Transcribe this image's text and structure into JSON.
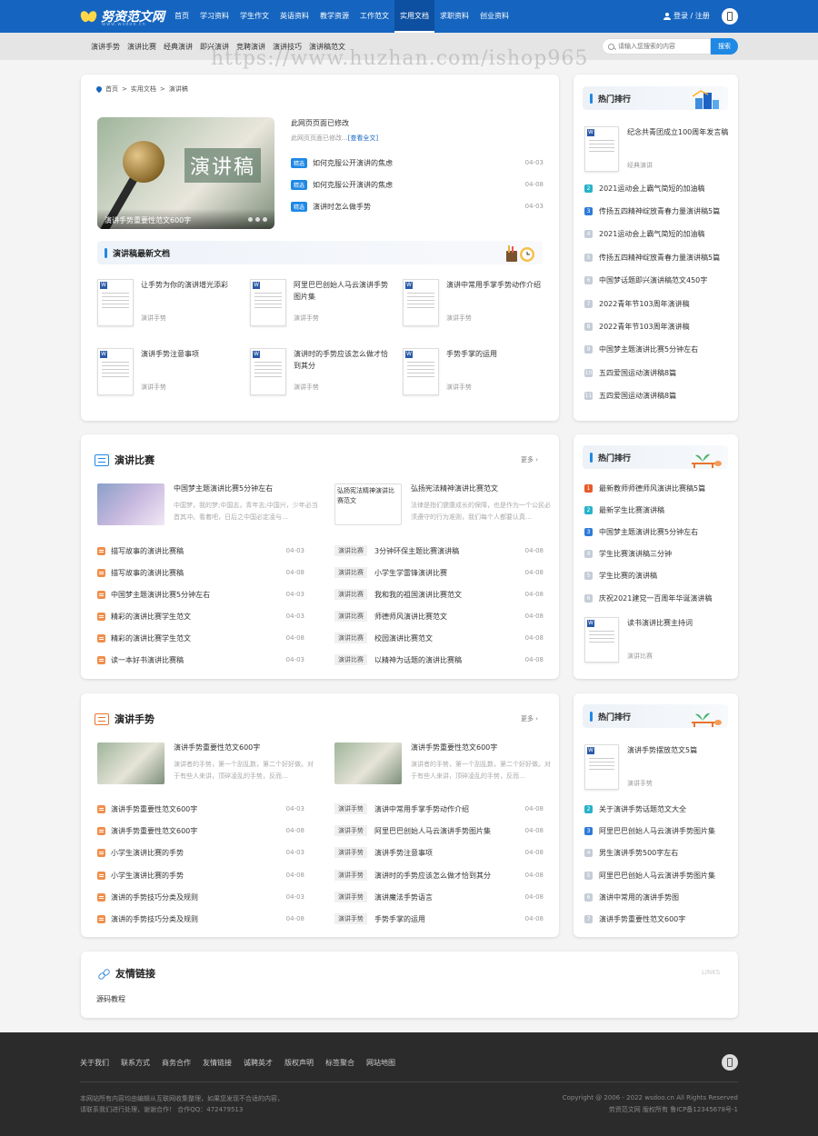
{
  "header": {
    "logo_text": "努资范文网",
    "logo_sub": "www.wsdoo.cn",
    "nav": [
      "首页",
      "学习资料",
      "学生作文",
      "英语资料",
      "教学资源",
      "工作范文",
      "实用文档",
      "求职资料",
      "创业资料"
    ],
    "active_nav": "实用文档",
    "login": "登录 / 注册"
  },
  "subnav": [
    "演讲手势",
    "演讲比赛",
    "经典演讲",
    "即兴演讲",
    "竞聘演讲",
    "演讲技巧",
    "演讲稿范文"
  ],
  "search": {
    "placeholder": "请输入您搜索的内容",
    "button": "搜索"
  },
  "watermark": "https://www.huzhan.com/ishop965",
  "breadcrumb": [
    "首页",
    "实用文档",
    "演讲稿"
  ],
  "banner": {
    "word": "演讲稿",
    "caption": "演讲手势重要性范文600字"
  },
  "headline": {
    "title": "此网页页面已修改",
    "desc": "此网页页面已修改...",
    "more": "[查看全文]",
    "items": [
      {
        "tag": "精选",
        "title": "如何克服公开演讲的焦虑",
        "date": "04-03"
      },
      {
        "tag": "精选",
        "title": "如何克服公开演讲的焦虑",
        "date": "04-08"
      },
      {
        "tag": "精选",
        "title": "演讲时怎么做手势",
        "date": "04-03"
      }
    ]
  },
  "latest": {
    "title": "演讲稿最新文档",
    "items": [
      {
        "title": "让手势为你的演讲增光添彩",
        "cat": "演讲手势"
      },
      {
        "title": "阿里巴巴创始人马云演讲手势图片集",
        "cat": "演讲手势"
      },
      {
        "title": "演讲中常用手掌手势动作介绍",
        "cat": "演讲手势"
      },
      {
        "title": "演讲手势注意事项",
        "cat": "演讲手势"
      },
      {
        "title": "演讲时的手势应该怎么做才恰到其分",
        "cat": "演讲手势"
      },
      {
        "title": "手势手掌的运用",
        "cat": "演讲手势"
      }
    ]
  },
  "hot1": {
    "title": "热门排行",
    "feature": {
      "title": "纪念共青团成立100周年发言稿",
      "cat": "经典演讲"
    },
    "items": [
      "2021运动会上霸气简短的加油稿",
      "传扬五四精神绽放青春力量演讲稿5篇",
      "2021运动会上霸气简短的加油稿",
      "传扬五四精神绽放青春力量演讲稿5篇",
      "中国梦话题即兴演讲稿范文450字",
      "2022青年节103周年演讲稿",
      "2022青年节103周年演讲稿",
      "中国梦主题演讲比赛5分钟左右",
      "五四爱国运动演讲稿8篇",
      "五四爱国运动演讲稿8篇"
    ],
    "nums": [
      "2",
      "3",
      "4",
      "5",
      "6",
      "7",
      "8",
      "9",
      "10",
      "11"
    ]
  },
  "contest": {
    "title": "演讲比赛",
    "more": "更多",
    "feat1": {
      "title": "中国梦主题演讲比赛5分钟左右",
      "desc": "中国梦，我的梦;中国志，青年志;中国兴，少年必当首其冲。看着吧，日后之中国必定凌与..."
    },
    "feat2": {
      "title": "弘扬宪法精神演讲比赛范文",
      "desc": "法律是指们健康成长的保障，也是作为一个公民必须遵守的行为准则，我们每个人都要认真...",
      "img_alt": "弘扬宪法精神演讲比赛范文"
    },
    "left": [
      {
        "title": "描写故事的演讲比赛稿",
        "date": "04-03"
      },
      {
        "title": "描写故事的演讲比赛稿",
        "date": "04-08"
      },
      {
        "title": "中国梦主题演讲比赛5分钟左右",
        "date": "04-03"
      },
      {
        "title": "精彩的演讲比赛学生范文",
        "date": "04-03"
      },
      {
        "title": "精彩的演讲比赛学生范文",
        "date": "04-08"
      },
      {
        "title": "读一本好书演讲比赛稿",
        "date": "04-03"
      }
    ],
    "right": [
      {
        "tag": "演讲比赛",
        "title": "3分钟环保主题比赛演讲稿",
        "date": "04-08"
      },
      {
        "tag": "演讲比赛",
        "title": "小学生学雷锋演讲比赛",
        "date": "04-08"
      },
      {
        "tag": "演讲比赛",
        "title": "我和我的祖国演讲比赛范文",
        "date": "04-08"
      },
      {
        "tag": "演讲比赛",
        "title": "师德师风演讲比赛范文",
        "date": "04-08"
      },
      {
        "tag": "演讲比赛",
        "title": "校园演讲比赛范文",
        "date": "04-08"
      },
      {
        "tag": "演讲比赛",
        "title": "以精神为话题的演讲比赛稿",
        "date": "04-08"
      }
    ]
  },
  "hot2": {
    "title": "热门排行",
    "items": [
      "最新教师师德师风演讲比赛稿5篇",
      "最新学生比赛演讲稿",
      "中国梦主题演讲比赛5分钟左右",
      "学生比赛演讲稿三分钟",
      "学生比赛的演讲稿",
      "庆祝2021建党一百周年华诞演讲稿"
    ],
    "nums": [
      "1",
      "2",
      "3",
      "4",
      "5",
      "6"
    ],
    "feature": {
      "title": "读书演讲比赛主持词",
      "cat": "演讲比赛"
    }
  },
  "gesture": {
    "title": "演讲手势",
    "more": "更多",
    "feat1": {
      "title": "演讲手势重要性范文600字",
      "desc": "演讲者的手势，第一个刮乱数，第二个好好做。对于有些人来讲，顶碎凌乱的手势，反而..."
    },
    "feat2": {
      "title": "演讲手势重要性范文600字",
      "desc": "演讲者的手势，第一个刮乱数，第二个好好做。对于有些人来讲，顶碎凌乱的手势，反而..."
    },
    "left": [
      {
        "title": "演讲手势重要性范文600字",
        "date": "04-03"
      },
      {
        "title": "演讲手势重要性范文600字",
        "date": "04-08"
      },
      {
        "title": "小学生演讲比赛的手势",
        "date": "04-03"
      },
      {
        "title": "小学生演讲比赛的手势",
        "date": "04-08"
      },
      {
        "title": "演讲的手势技巧分类及规则",
        "date": "04-03"
      },
      {
        "title": "演讲的手势技巧分类及规则",
        "date": "04-08"
      }
    ],
    "right": [
      {
        "tag": "演讲手势",
        "title": "演讲中常用手掌手势动作介绍",
        "date": "04-08"
      },
      {
        "tag": "演讲手势",
        "title": "阿里巴巴创始人马云演讲手势图片集",
        "date": "04-08"
      },
      {
        "tag": "演讲手势",
        "title": "演讲手势注意事项",
        "date": "04-08"
      },
      {
        "tag": "演讲手势",
        "title": "演讲时的手势应该怎么做才恰到其分",
        "date": "04-08"
      },
      {
        "tag": "演讲手势",
        "title": "演讲魔法手势语言",
        "date": "04-08"
      },
      {
        "tag": "演讲手势",
        "title": "手势手掌的运用",
        "date": "04-08"
      }
    ]
  },
  "hot3": {
    "title": "热门排行",
    "feature": {
      "title": "演讲手势摆放范文5篇",
      "cat": "演讲手势"
    },
    "items": [
      "关于演讲手势话题范文大全",
      "阿里巴巴创始人马云演讲手势图片集",
      "男生演讲手势500字左右",
      "阿里巴巴创始人马云演讲手势图片集",
      "演讲中常用的演讲手势图",
      "演讲手势重要性范文600字"
    ],
    "nums": [
      "2",
      "3",
      "4",
      "5",
      "6",
      "7"
    ]
  },
  "links": {
    "title": "友情链接",
    "en": "LINKS",
    "items": [
      "源码教程"
    ]
  },
  "footer": {
    "nav": [
      "关于我们",
      "联系方式",
      "商务合作",
      "友情链接",
      "诚聘英才",
      "版权声明",
      "标签聚合",
      "网站地图"
    ],
    "left1": "本网站所有内容均由编辑从互联网收集整理，如果您发现不合适的内容，",
    "left2": "请联系我们进行处理，谢谢合作！ 合作QQ：472479513",
    "right1": "Copyright @ 2006 - 2022 wsdoo.cn All Rights Reserved",
    "right2": "劳资范文网 版权所有   鲁ICP备12345678号-1"
  }
}
